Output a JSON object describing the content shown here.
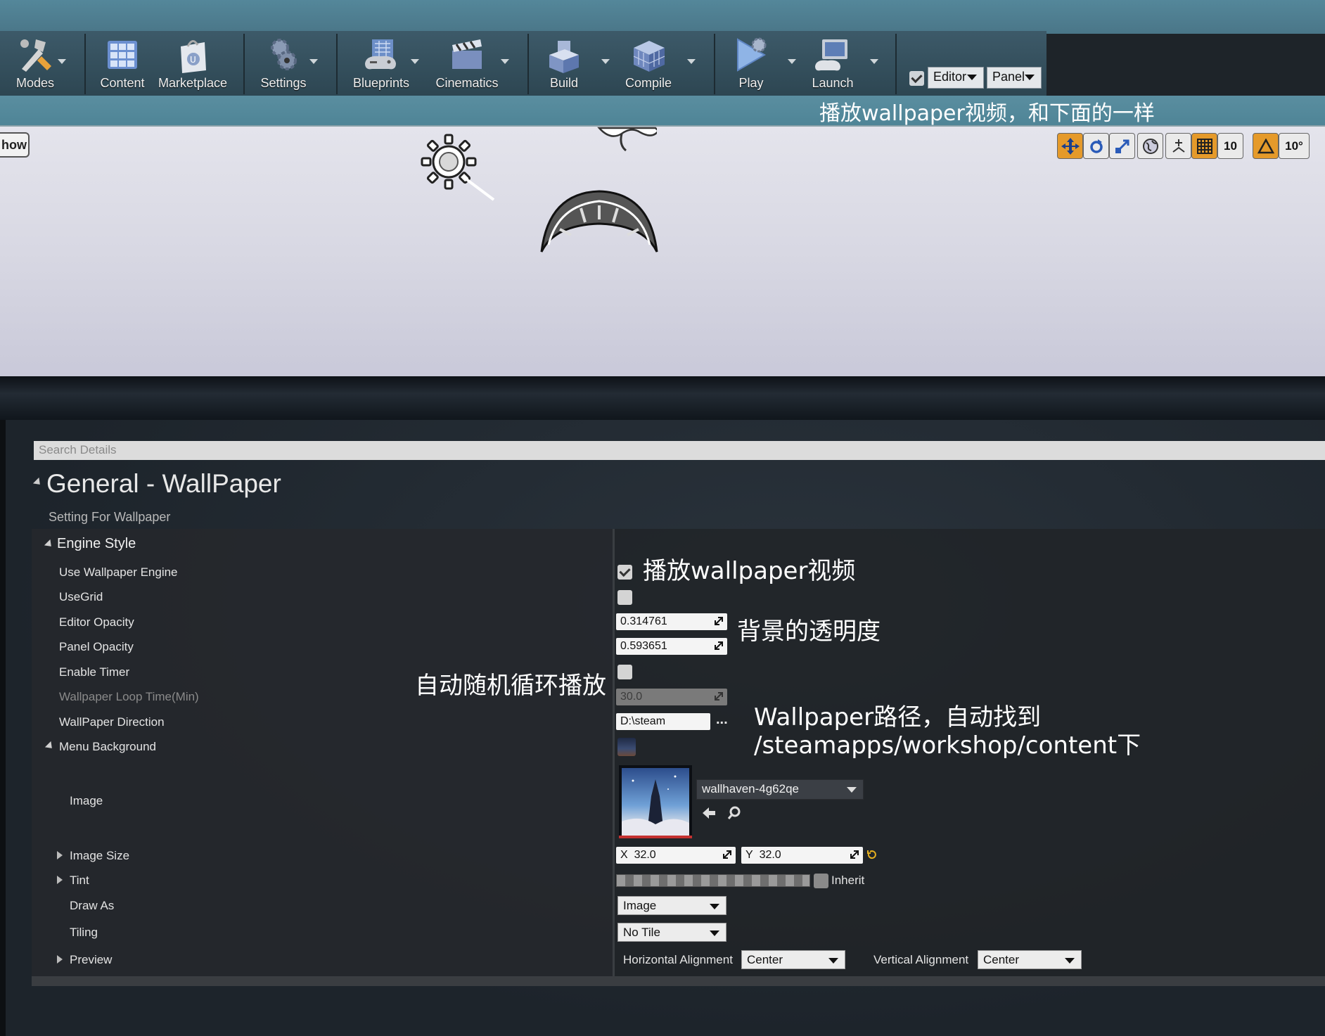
{
  "toolbar": {
    "buttons": [
      {
        "label": "Modes",
        "icon": "modes-icon"
      },
      {
        "label": "Content",
        "icon": "content-icon"
      },
      {
        "label": "Marketplace",
        "icon": "marketplace-icon"
      },
      {
        "label": "Settings",
        "icon": "settings-icon"
      },
      {
        "label": "Blueprints",
        "icon": "blueprints-icon"
      },
      {
        "label": "Cinematics",
        "icon": "cinematics-icon"
      },
      {
        "label": "Build",
        "icon": "build-icon"
      },
      {
        "label": "Compile",
        "icon": "compile-icon"
      },
      {
        "label": "Play",
        "icon": "play-icon"
      },
      {
        "label": "Launch",
        "icon": "launch-icon"
      }
    ],
    "editor_label": "Editor",
    "panel_label": "Panel",
    "caption": "播放wallpaper视频，和下面的一样"
  },
  "viewport": {
    "show_label": "how",
    "grid_snap_value": "10",
    "rotation_snap_value": "10°"
  },
  "details": {
    "search_placeholder": "Search Details",
    "section_title": "General - WallPaper",
    "section_subtitle": "Setting For Wallpaper",
    "category": "Engine Style",
    "props": {
      "use_wallpaper_engine": "Use Wallpaper Engine",
      "use_grid": "UseGrid",
      "editor_opacity": "Editor Opacity",
      "panel_opacity": "Panel Opacity",
      "enable_timer": "Enable Timer",
      "loop_time": "Wallpaper Loop Time(Min)",
      "direction": "WallPaper Direction",
      "menu_background": "Menu Background",
      "image": "Image",
      "image_size": "Image Size",
      "tint": "Tint",
      "draw_as": "Draw As",
      "tiling": "Tiling",
      "preview": "Preview"
    },
    "values": {
      "use_wallpaper_engine": true,
      "use_grid": false,
      "editor_opacity": "0.314761",
      "panel_opacity": "0.593651",
      "enable_timer": false,
      "loop_time": "30.0",
      "direction": "D:\\steam",
      "browse": "...",
      "image_asset": "wallhaven-4g62qe",
      "size_x_label": "X",
      "size_x": "32.0",
      "size_y_label": "Y",
      "size_y": "32.0",
      "inherit_label": "Inherit",
      "draw_as": "Image",
      "tiling": "No Tile",
      "h_align_label": "Horizontal Alignment",
      "h_align": "Center",
      "v_align_label": "Vertical Alignment",
      "v_align": "Center"
    },
    "annotations": {
      "play": "播放wallpaper视频",
      "opacity": "背景的透明度",
      "timer": "自动随机循环播放",
      "path_line1": "Wallpaper路径，自动找到",
      "path_line2": "/steamapps/workshop/content下"
    }
  },
  "colors": {
    "toolbar_bg": "#2d4652",
    "viewport_bg": "#dcdce6",
    "panel_bg": "#25282c",
    "accent_orange": "#e59a2a"
  }
}
